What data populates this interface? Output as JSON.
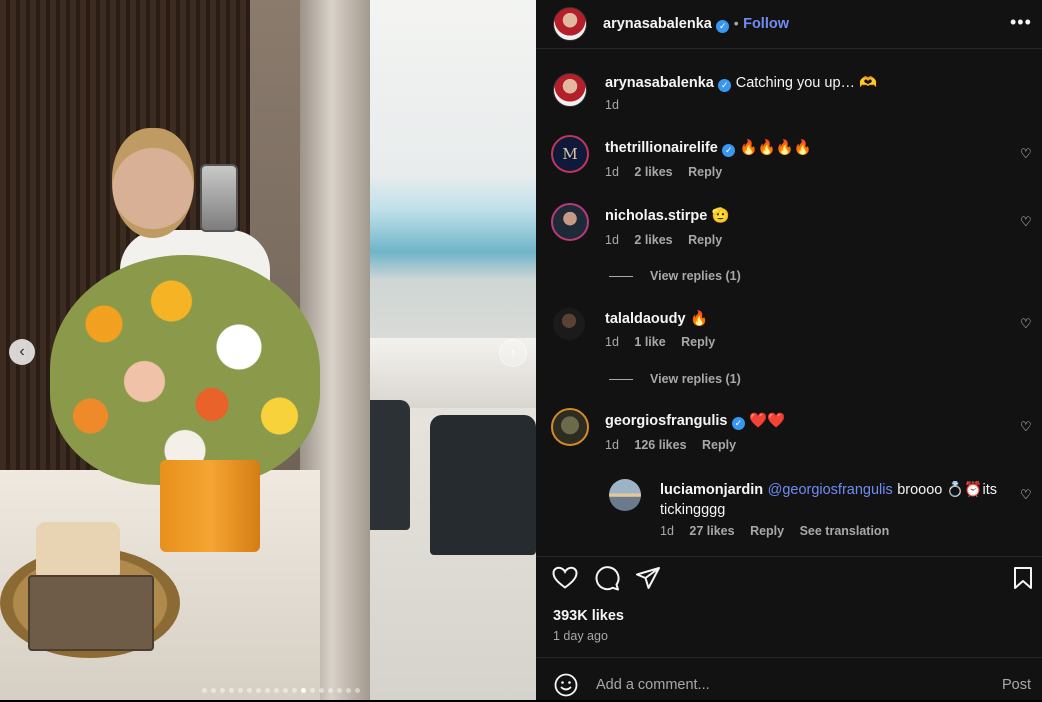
{
  "post": {
    "author": "arynasabalenka",
    "follow_label": "Follow",
    "separator": "•",
    "caption": "Catching you up… 🫶",
    "caption_time": "1d"
  },
  "comments": [
    {
      "user": "thetrillionairelife",
      "verified": true,
      "text": "🔥🔥🔥🔥",
      "time": "1d",
      "likes": "2 likes",
      "reply": "Reply",
      "avatar_letter": "M"
    },
    {
      "user": "nicholas.stirpe",
      "verified": false,
      "text": "🫡",
      "time": "1d",
      "likes": "2 likes",
      "reply": "Reply",
      "view_replies": "View replies (1)"
    },
    {
      "user": "talaldaoudy",
      "verified": false,
      "text": "🔥",
      "time": "1d",
      "likes": "1 like",
      "reply": "Reply",
      "view_replies": "View replies (1)"
    },
    {
      "user": "georgiosfrangulis",
      "verified": true,
      "text": "❤️❤️",
      "time": "1d",
      "likes": "126 likes",
      "reply": "Reply"
    }
  ],
  "reply": {
    "user": "luciamonjardin",
    "mention": "@georgiosfrangulis",
    "text_line1": "broooo 💍⏰its",
    "text_line2": "tickingggg",
    "time": "1d",
    "likes": "27 likes",
    "reply": "Reply",
    "translation": "See translation"
  },
  "engagement": {
    "likes": "393K likes",
    "posted": "1 day ago"
  },
  "composer": {
    "placeholder": "Add a comment...",
    "post_label": "Post"
  },
  "icons": {
    "like": "heart-icon",
    "comment": "comment-icon",
    "share": "share-icon",
    "save": "bookmark-icon",
    "emoji": "emoji-icon",
    "more": "more-icon"
  }
}
